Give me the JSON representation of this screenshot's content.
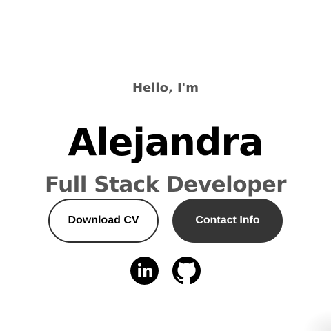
{
  "hero": {
    "greeting": "Hello, I'm",
    "name": "Alejandra",
    "role": "Full Stack Developer"
  },
  "buttons": {
    "download_cv": "Download CV",
    "contact_info": "Contact Info"
  },
  "socials": {
    "items": [
      {
        "icon": "linkedin-icon"
      },
      {
        "icon": "github-icon"
      }
    ]
  },
  "colors": {
    "text_primary": "#000000",
    "text_secondary": "#555555",
    "button_dark": "#353535",
    "background": "#ffffff"
  }
}
